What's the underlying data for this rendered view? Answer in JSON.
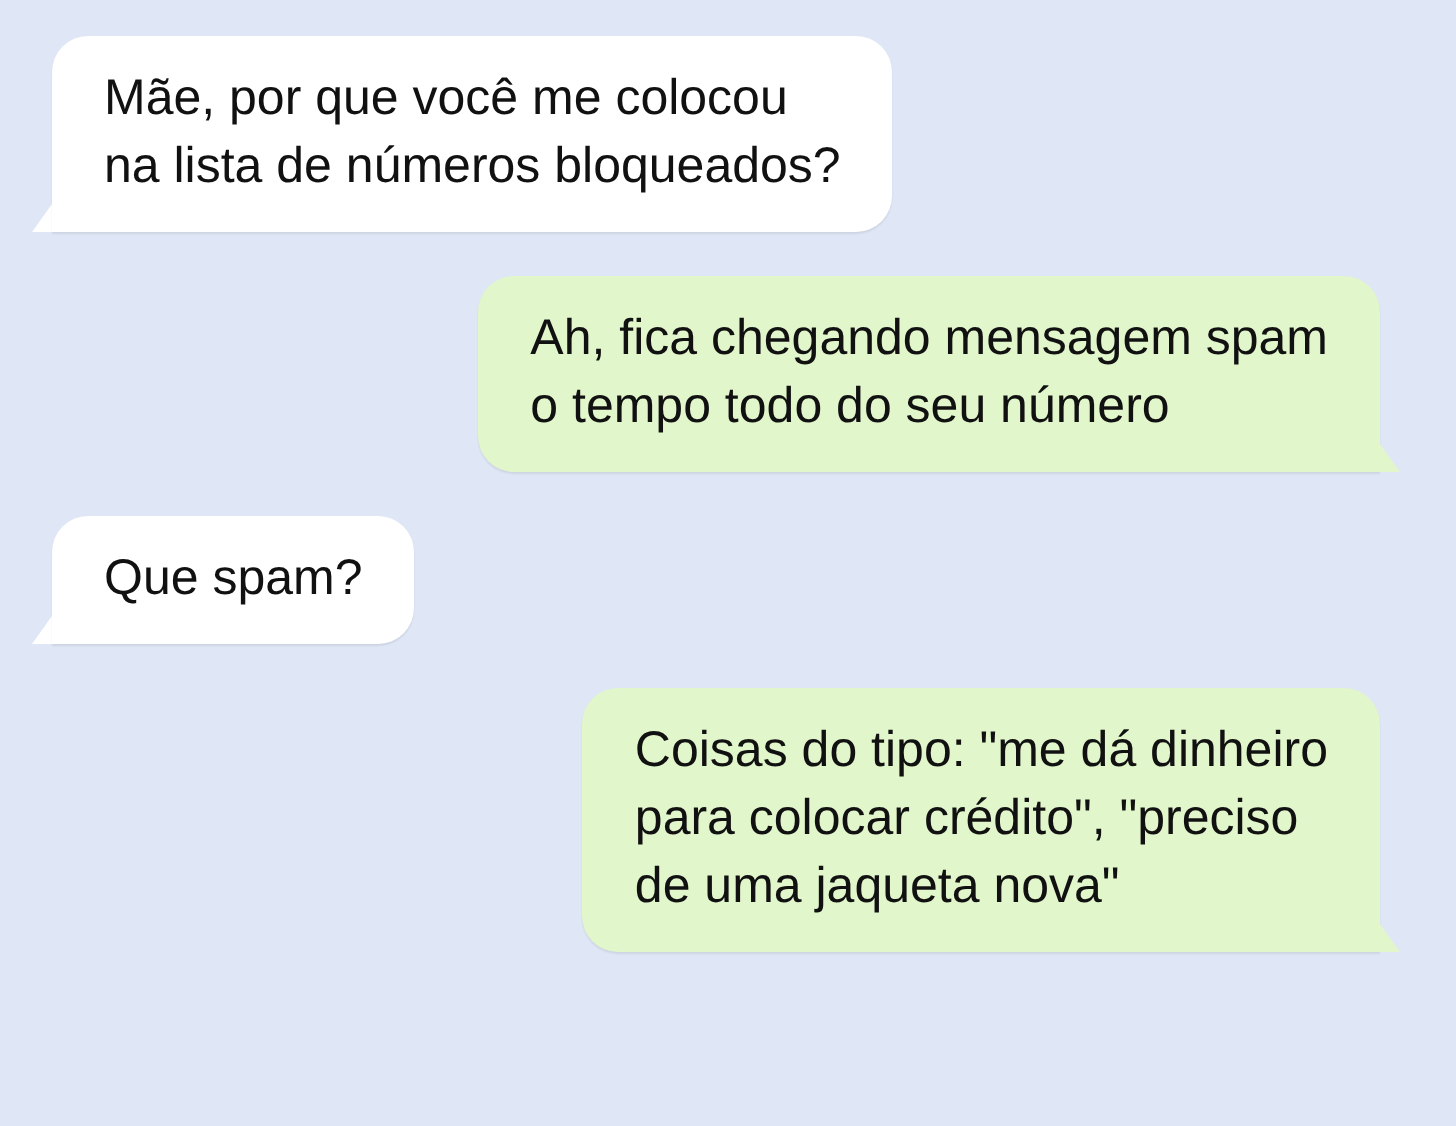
{
  "messages": [
    {
      "outgoing": false,
      "text": "Mãe, por que você me colocou\nna lista de números bloqueados?"
    },
    {
      "outgoing": true,
      "text": "Ah, fica chegando mensagem spam\no tempo todo do seu número"
    },
    {
      "outgoing": false,
      "text": "Que spam?"
    },
    {
      "outgoing": true,
      "text": "Coisas do tipo: \"me dá dinheiro\npara colocar crédito\", \"preciso\nde uma jaqueta nova\""
    }
  ]
}
